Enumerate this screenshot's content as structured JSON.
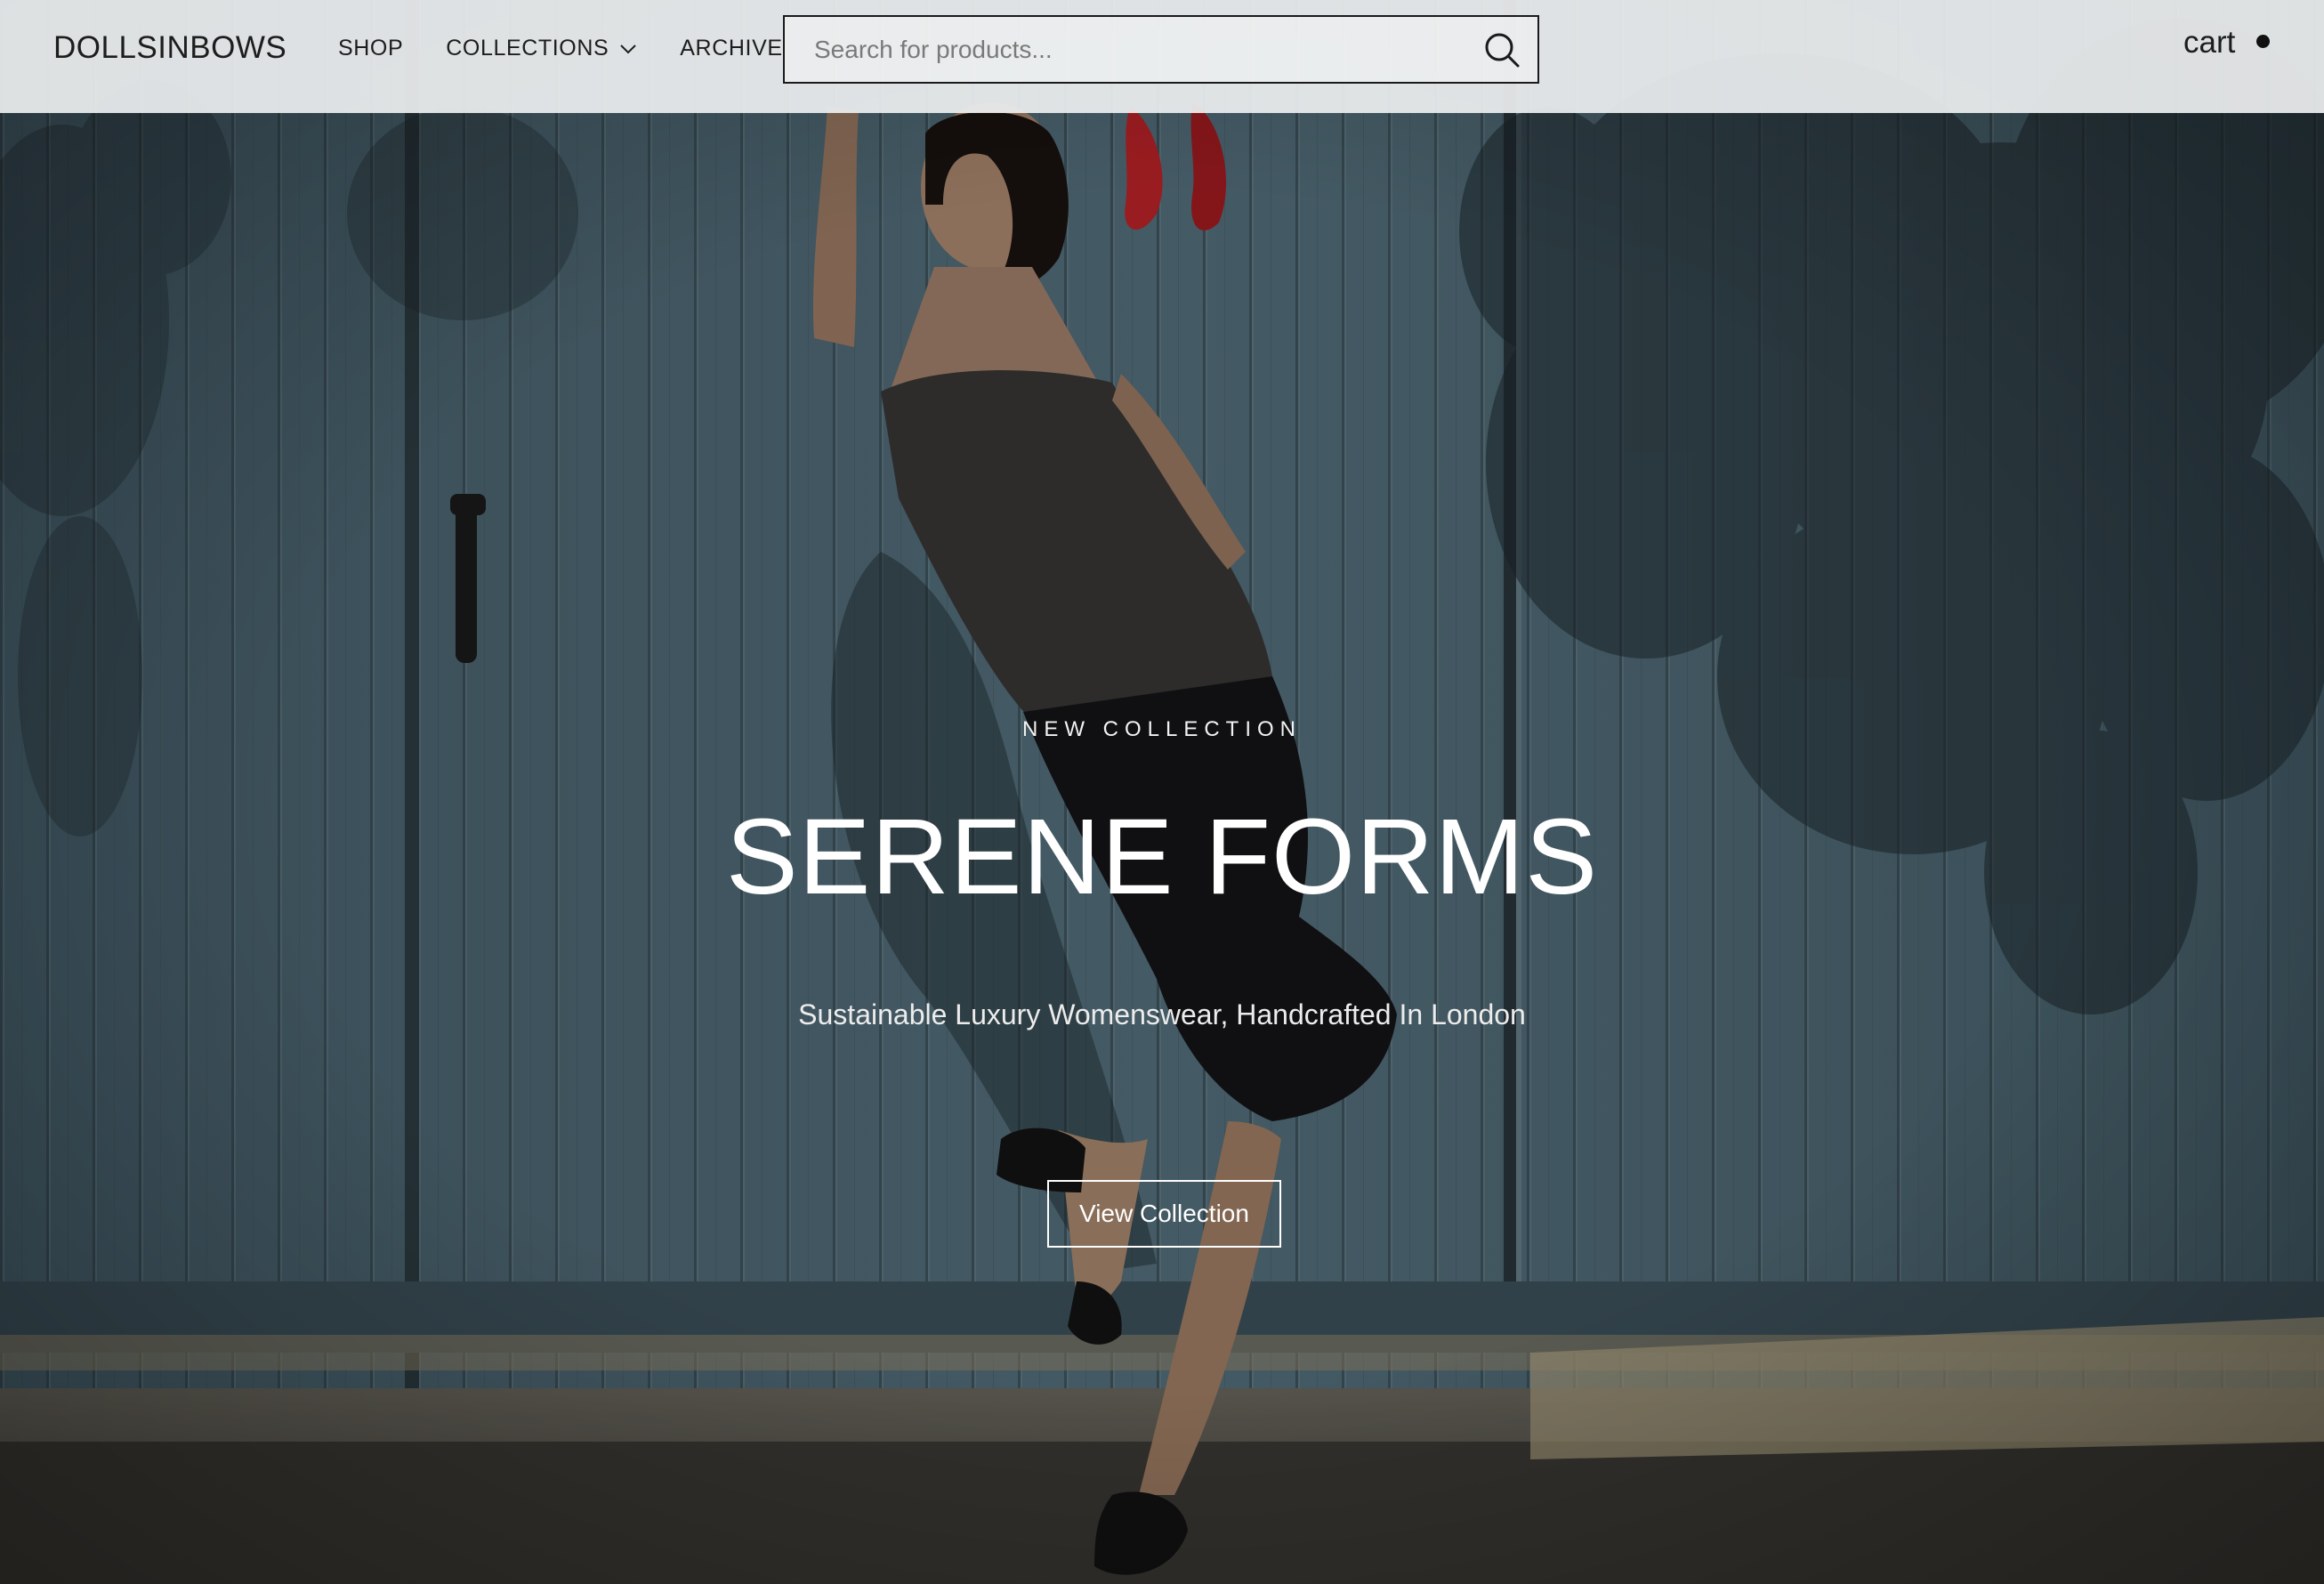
{
  "brand": {
    "logo_text": "DOLLSINBOWS"
  },
  "nav": {
    "items": [
      {
        "label": "SHOP"
      },
      {
        "label": "COLLECTIONS",
        "has_dropdown": true
      },
      {
        "label": "ARCHIVE"
      }
    ]
  },
  "search": {
    "placeholder": "Search for products...",
    "value": ""
  },
  "cart": {
    "label": "cart",
    "has_items_indicator": true
  },
  "hero": {
    "eyebrow": "NEW COLLECTION",
    "title": "SERENE FORMS",
    "subtitle": "Sustainable Luxury Womenswear, Handcrafted In London",
    "cta_label": "View Collection"
  },
  "colors": {
    "header_bg": "#eceeef",
    "text_dark": "#1d1d1d",
    "hero_text": "#ffffff",
    "door_blue": "#4f6874",
    "accent_red": "#c4252a"
  }
}
